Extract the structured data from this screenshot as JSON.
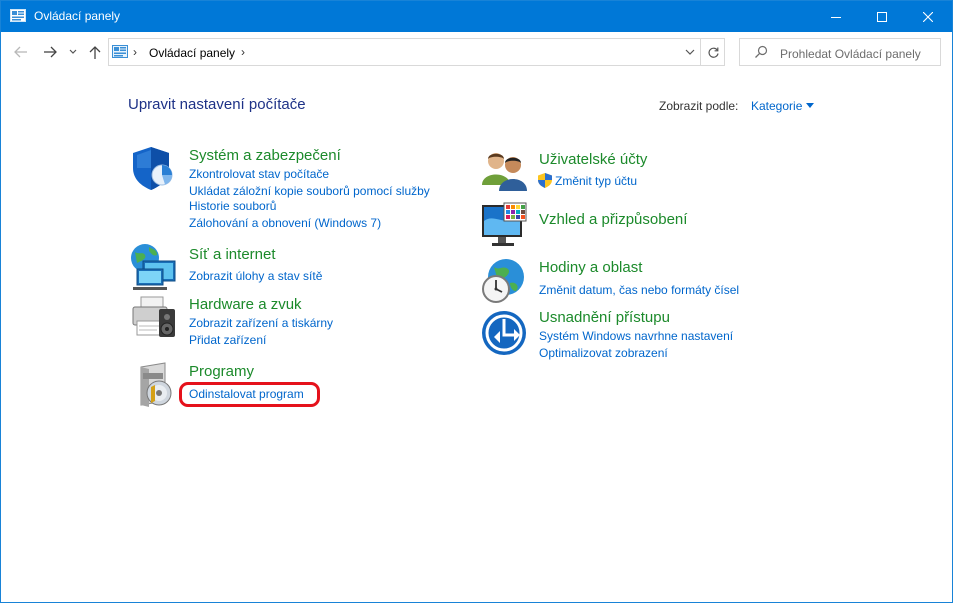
{
  "window": {
    "title": "Ovládací panely"
  },
  "address": {
    "crumb": "Ovládací panely",
    "separator": "›",
    "dropdown_icon": "chevron-down-icon",
    "refresh_icon": "refresh-icon"
  },
  "search": {
    "placeholder": "Prohledat Ovládací panely"
  },
  "main": {
    "heading": "Upravit nastavení počítače",
    "view_by_label": "Zobrazit podle:",
    "view_by_value": "Kategorie"
  },
  "categories": {
    "system": {
      "title": "Systém a zabezpečení",
      "icon": "shield-icon",
      "links": [
        "Zkontrolovat stav počítače",
        "Ukládat záložní kopie souborů pomocí služby",
        "Historie souborů",
        "Zálohování a obnovení (Windows 7)"
      ]
    },
    "network": {
      "title": "Síť a internet",
      "icon": "network-globe-icon",
      "links": [
        "Zobrazit úlohy a stav sítě"
      ]
    },
    "hardware": {
      "title": "Hardware a zvuk",
      "icon": "printer-speaker-icon",
      "links": [
        "Zobrazit zařízení a tiskárny",
        "Přidat zařízení"
      ]
    },
    "programs": {
      "title": "Programy",
      "icon": "programs-disc-icon",
      "links": [
        "Odinstalovat program"
      ]
    },
    "users": {
      "title": "Uživatelské účty",
      "icon": "users-icon",
      "links": [
        "Změnit typ účtu"
      ]
    },
    "appearance": {
      "title": "Vzhled a přizpůsobení",
      "icon": "monitor-palette-icon",
      "links": []
    },
    "clock": {
      "title": "Hodiny a oblast",
      "icon": "clock-globe-icon",
      "links": [
        "Změnit datum, čas nebo formáty čísel"
      ]
    },
    "access": {
      "title": "Usnadnění přístupu",
      "icon": "accessibility-icon",
      "links": [
        "Systém Windows navrhne nastavení",
        "Optimalizovat zobrazení"
      ]
    }
  },
  "colors": {
    "titlebar": "#0078d7",
    "category_title": "#1c8a2b",
    "link": "#0066cc",
    "heading": "#1e3287",
    "highlight": "#e5111b"
  }
}
